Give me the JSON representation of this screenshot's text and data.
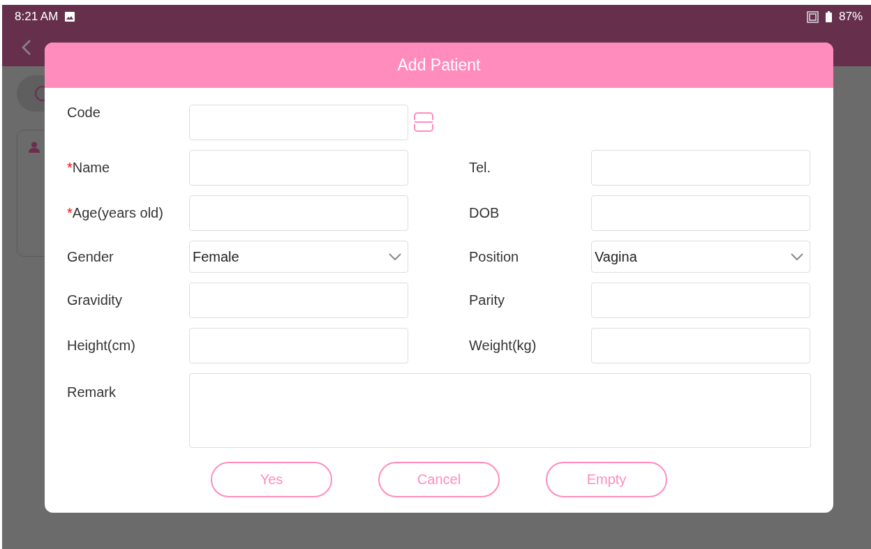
{
  "status_bar": {
    "time": "8:21 AM",
    "battery": "87%"
  },
  "dialog": {
    "title": "Add Patient",
    "rows": [
      {
        "left": {
          "label": "Code",
          "kind": "text",
          "scan": true
        }
      },
      {
        "left": {
          "required_mark": "*",
          "label": "Name",
          "kind": "text"
        },
        "right": {
          "label": "Tel.",
          "kind": "text"
        }
      },
      {
        "left": {
          "required_mark": "*",
          "label": "Age(years old)",
          "kind": "text"
        },
        "right": {
          "label": "DOB",
          "kind": "text"
        }
      },
      {
        "left": {
          "label": "Gender",
          "kind": "select",
          "value": "Female"
        },
        "right": {
          "label": "Position",
          "kind": "select",
          "value": "Vagina"
        }
      },
      {
        "left": {
          "label": "Gravidity",
          "kind": "text"
        },
        "right": {
          "label": "Parity",
          "kind": "text"
        }
      },
      {
        "left": {
          "label": "Height(cm)",
          "kind": "text"
        },
        "right": {
          "label": "Weight(kg)",
          "kind": "text"
        }
      },
      {
        "left": {
          "label": "Remark",
          "kind": "textarea"
        }
      }
    ],
    "buttons": [
      "Yes",
      "Cancel",
      "Empty"
    ]
  }
}
